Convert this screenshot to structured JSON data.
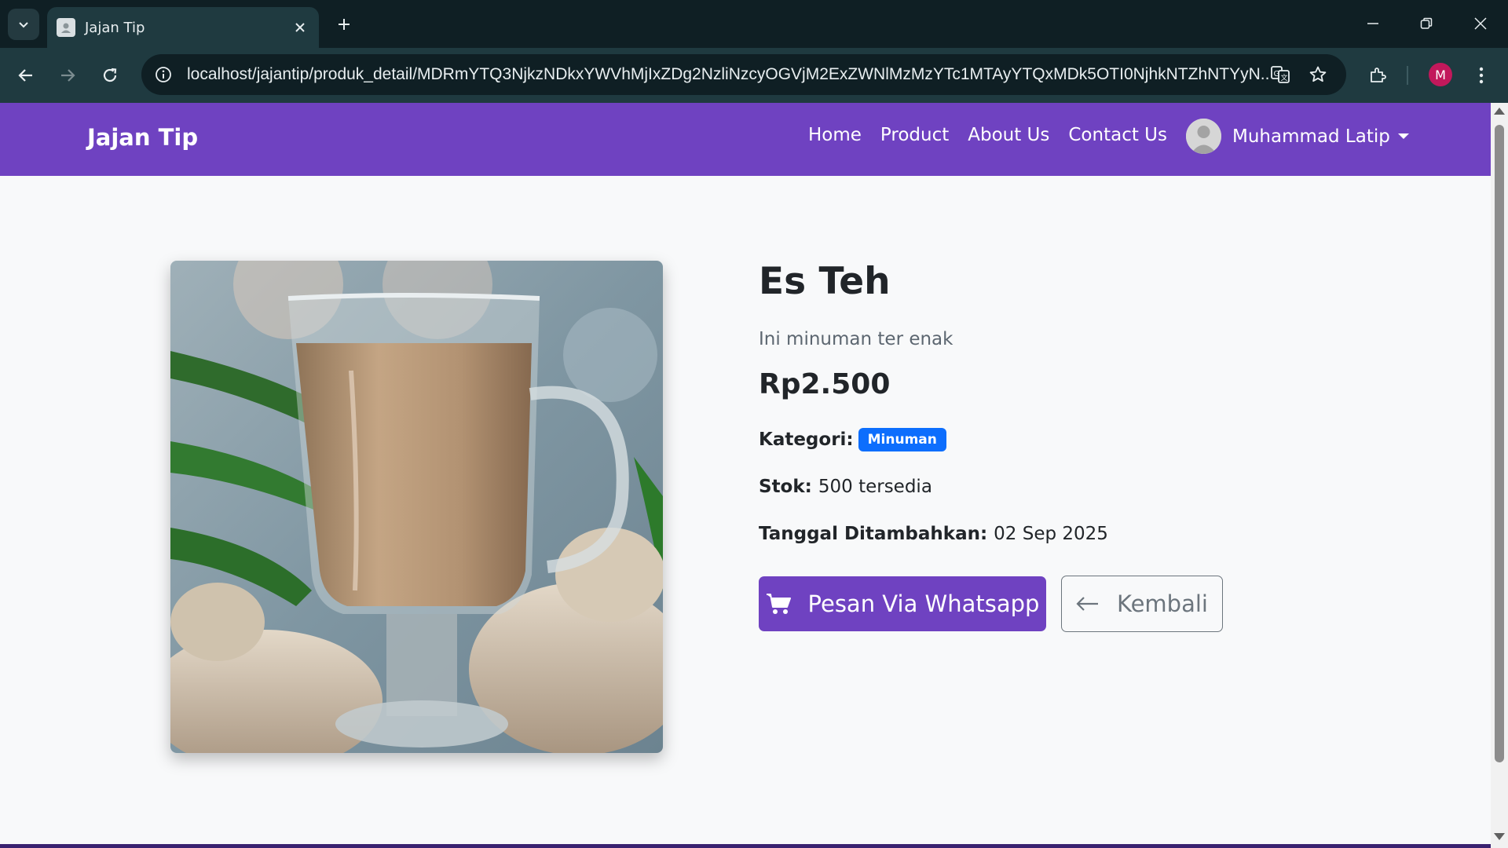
{
  "browser": {
    "tab_title": "Jajan Tip",
    "url": "localhost/jajantip/produk_detail/MDRmYTQ3NjkzNDkxYWVhMjIxZDg2NzliNzcyOGVjM2ExZWNlMzMzYTc1MTAyYTQxMDk5OTI0NjhkNTZhNTYyN...",
    "profile_initial": "M",
    "icons": [
      "tab-search-icon",
      "close-icon",
      "plus-icon",
      "minimize-icon",
      "restore-icon",
      "close-window-icon",
      "back-icon",
      "forward-icon",
      "reload-icon",
      "info-icon",
      "translate-icon",
      "star-icon",
      "extensions-icon",
      "more-icon"
    ]
  },
  "navbar": {
    "brand": "Jajan Tip",
    "links": [
      "Home",
      "Product",
      "About Us",
      "Contact Us"
    ],
    "user_name": "Muhammad Latip"
  },
  "product": {
    "title": "Es Teh",
    "description": "Ini minuman ter enak",
    "price": "Rp2.500",
    "category_label": "Kategori:",
    "category": "Minuman",
    "stock_label": "Stok:",
    "stock": "500 tersedia",
    "date_label": "Tanggal Ditambahkan:",
    "date": "02 Sep 2025"
  },
  "actions": {
    "order_label": "Pesan Via Whatsapp",
    "back_label": "Kembali"
  },
  "colors": {
    "primary": "#6f42c1",
    "badge": "#0d6efd",
    "browser_dark": "#0f1f24",
    "browser_toolbar": "#1f3a40"
  }
}
